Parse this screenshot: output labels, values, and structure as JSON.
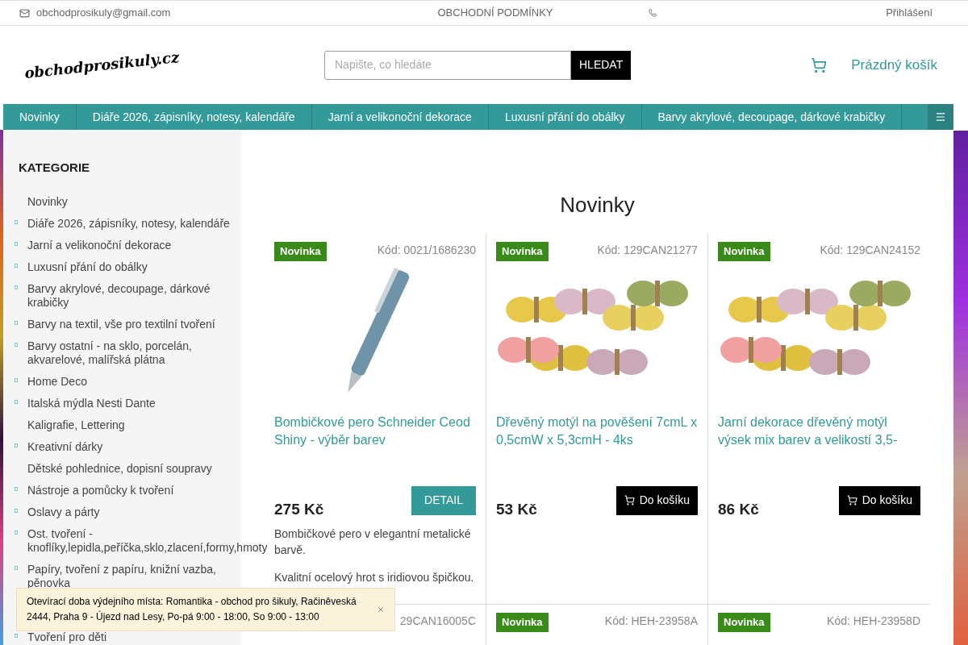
{
  "topbar": {
    "email": "obchodprosikuly@gmail.com",
    "terms": "OBCHODNÍ PODMÍNKY",
    "login": "Přihlášení"
  },
  "header": {
    "logo": "obchodprosikuly.cz",
    "search": {
      "placeholder": "Napište, co hledáte",
      "button": "HLEDAT"
    },
    "cart": "Prázdný košík"
  },
  "nav": [
    "Novinky",
    "Diáře 2026, zápisníky, notesy, kalendáře",
    "Jarní a velikonoční dekorace",
    "Luxusní přání do obálky",
    "Barvy akrylové, decoupage, dárkové krabičky"
  ],
  "sidebar": {
    "title": "KATEGORIE",
    "items": [
      {
        "label": "Novinky",
        "expandable": false
      },
      {
        "label": "Diáře 2026, zápisníky, notesy, kalendáře",
        "expandable": true
      },
      {
        "label": "Jarní a velikonoční dekorace",
        "expandable": true
      },
      {
        "label": "Luxusní přání do obálky",
        "expandable": true
      },
      {
        "label": "Barvy akrylové, decoupage, dárkové krabičky",
        "expandable": true
      },
      {
        "label": "Barvy na textil, vše pro textilní tvoření",
        "expandable": true
      },
      {
        "label": "Barvy ostatní - na sklo, porcelán, akvarelové, malířská plátna",
        "expandable": true
      },
      {
        "label": "Home Deco",
        "expandable": true
      },
      {
        "label": "Italská mýdla Nesti Dante",
        "expandable": true
      },
      {
        "label": "Kaligrafie, Lettering",
        "expandable": false
      },
      {
        "label": "Kreativní dárky",
        "expandable": true
      },
      {
        "label": "Dětské pohlednice, dopisní soupravy",
        "expandable": false
      },
      {
        "label": "Nástroje a pomůcky k tvoření",
        "expandable": true
      },
      {
        "label": "Oslavy a párty",
        "expandable": true
      },
      {
        "label": "Ost. tvoření - knoflíky,lepidla,peříčka,sklo,zlacení,formy,hmoty",
        "expandable": true
      },
      {
        "label": "Papíry, tvoření z papíru, knižní vazba, pěnovka",
        "expandable": true
      },
      {
        "label": "Tvoření pro děti",
        "expandable": true
      }
    ]
  },
  "main": {
    "title": "Novinky",
    "products": [
      {
        "badge": "Novinka",
        "code": "Kód: 0021/1686230",
        "name": "Bombičkové pero Schneider Ceod Shiny - výběr barev",
        "price": "275 Kč",
        "button": {
          "kind": "detail",
          "label": "DETAIL"
        },
        "description": [
          "Bombičkové pero v elegantní metalické barvě.",
          "Kvalitní ocelový hrot s iridiovou špičkou."
        ]
      },
      {
        "badge": "Novinka",
        "code": "Kód: 129CAN21277",
        "name": "Dřevěný motýl na pověšení 7cmL x 0,5cmW x 5,3cmH - 4ks",
        "price": "53 Kč",
        "button": {
          "kind": "cart",
          "label": "Do košíku"
        }
      },
      {
        "badge": "Novinka",
        "code": "Kód: 129CAN24152",
        "name": "Jarní dekorace dřevěný motýl výsek mix barev a velikostí 3,5-",
        "price": "86 Kč",
        "button": {
          "kind": "cart",
          "label": "Do košíku"
        }
      }
    ],
    "next_row": [
      {
        "code": "29CAN16005C"
      },
      {
        "badge": "Novinka",
        "code": "Kód: HEH-23958A"
      },
      {
        "badge": "Novinka",
        "code": "Kód: HEH-23958D"
      }
    ]
  },
  "notice": "Otevírací doba výdejního místa: Romantika - obchod pro šikuly, Račiněveská 2444, Praha 9 - Újezd nad Lesy, Po-pá 9:00 - 18:00, So 9:00 - 13:00"
}
